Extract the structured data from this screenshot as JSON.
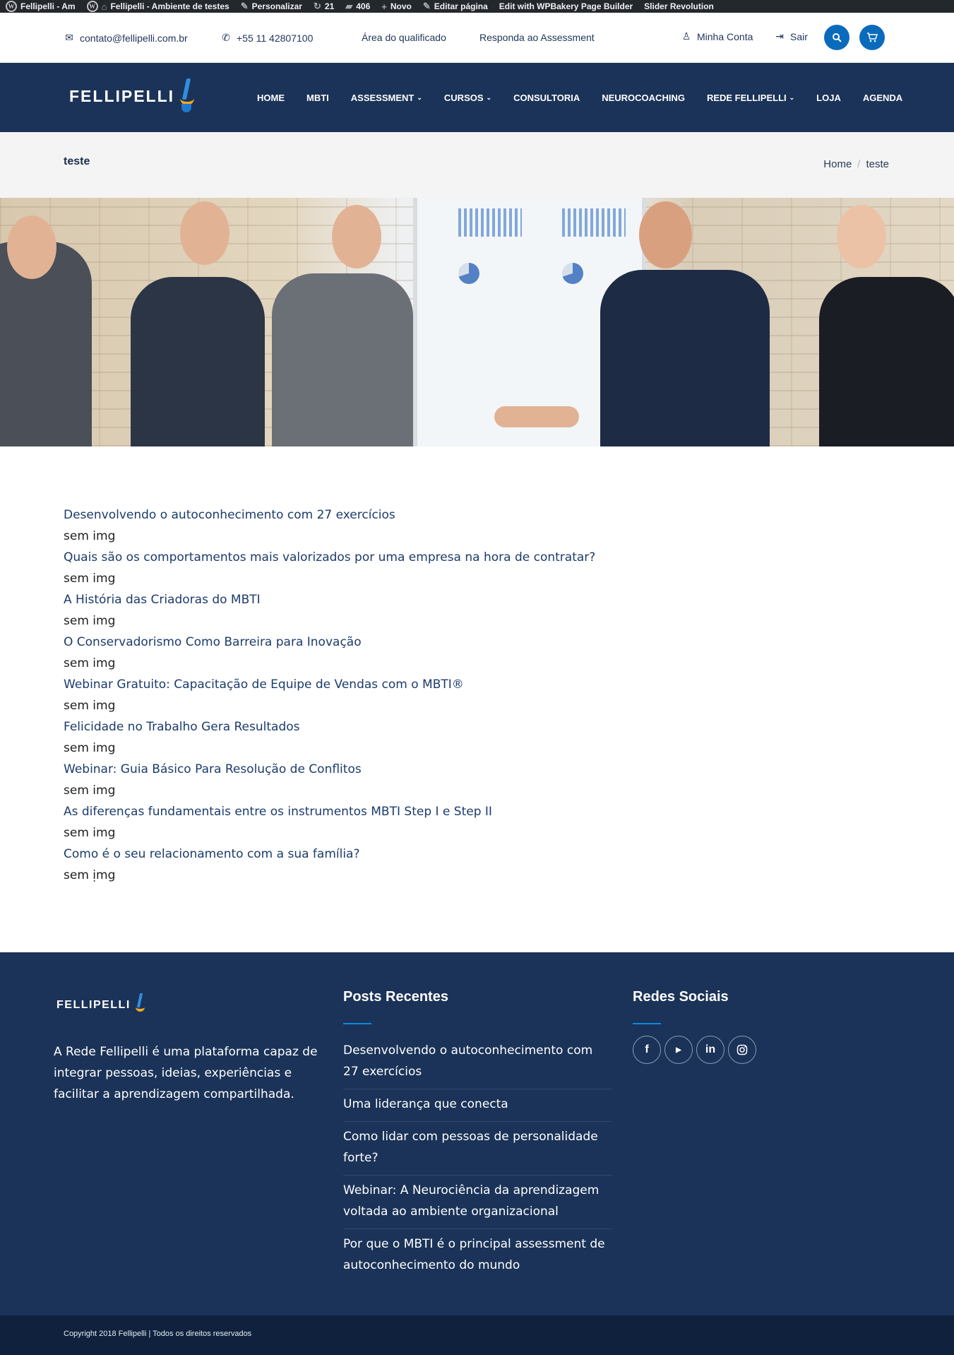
{
  "admin_bar": {
    "site_short": "Fellipelli - Am",
    "site_name": "Fellipelli - Ambiente de testes",
    "customize": "Personalizar",
    "updates_count": "21",
    "comments_count": "406",
    "new_label": "Novo",
    "edit_page": "Editar página",
    "wpbakery": "Edit with WPBakery Page Builder",
    "slider": "Slider Revolution"
  },
  "topbar": {
    "email": "contato@fellipelli.com.br",
    "phone": "+55 11 42807100",
    "qualified_area": "Área do qualificado",
    "assessment_link": "Responda ao Assessment",
    "account": "Minha Conta",
    "logout": "Sair"
  },
  "brand": {
    "name": "FELLIPELLI"
  },
  "nav": {
    "items": [
      {
        "label": "HOME",
        "dropdown": false
      },
      {
        "label": "MBTI",
        "dropdown": false
      },
      {
        "label": "ASSESSMENT",
        "dropdown": true
      },
      {
        "label": "CURSOS",
        "dropdown": true
      },
      {
        "label": "CONSULTORIA",
        "dropdown": false
      },
      {
        "label": "NEUROCOACHING",
        "dropdown": false
      },
      {
        "label": "REDE FELLIPELLI",
        "dropdown": true
      },
      {
        "label": "LOJA",
        "dropdown": false
      },
      {
        "label": "AGENDA",
        "dropdown": false
      }
    ]
  },
  "page": {
    "title": "teste",
    "breadcrumb": [
      "Home",
      "teste"
    ]
  },
  "posts": [
    {
      "title": "Desenvolvendo o autoconhecimento com 27 exercícios",
      "image_text": "sem img"
    },
    {
      "title": "Quais são os comportamentos mais valorizados por uma empresa na hora de contratar?",
      "image_text": "sem img"
    },
    {
      "title": "A História das Criadoras do MBTI",
      "image_text": "sem img"
    },
    {
      "title": "O Conservadorismo Como Barreira para Inovação",
      "image_text": "sem img"
    },
    {
      "title": "Webinar Gratuito: Capacitação de Equipe de Vendas com o MBTI®",
      "image_text": "sem img"
    },
    {
      "title": "Felicidade no Trabalho Gera Resultados",
      "image_text": "sem img"
    },
    {
      "title": "Webinar: Guia Básico Para Resolução de Conflitos",
      "image_text": "sem img"
    },
    {
      "title": "As diferenças fundamentais entre os instrumentos MBTI Step I e Step II",
      "image_text": "sem img"
    },
    {
      "title": "Como é o seu relacionamento com a sua família?",
      "image_text": "sem img"
    }
  ],
  "overflow_text": "sem img",
  "footer": {
    "about": "A Rede Fellipelli é uma plataforma capaz de integrar pessoas, ideias, experiências e facilitar a aprendizagem compartilhada.",
    "recent_heading": "Posts Recentes",
    "recent_posts": [
      "Desenvolvendo o autoconhecimento com 27 exercícios",
      "Uma liderança que conecta",
      "Como lidar com pessoas de personalidade forte?",
      "Webinar: A Neurociência da aprendizagem voltada ao ambiente organizacional",
      "Por que o MBTI é o principal assessment de autoconhecimento do mundo"
    ],
    "social_heading": "Redes Sociais",
    "social_icons": [
      "facebook-icon",
      "youtube-icon",
      "linkedin-icon",
      "instagram-icon"
    ],
    "copyright": "Copyright 2018 Fellipelli | Todos os direitos reservados"
  },
  "colors": {
    "navy": "#1b3358",
    "accent_blue": "#0a6bbd",
    "admin_bar": "#23282d",
    "copyright_bg": "#0f213d"
  }
}
